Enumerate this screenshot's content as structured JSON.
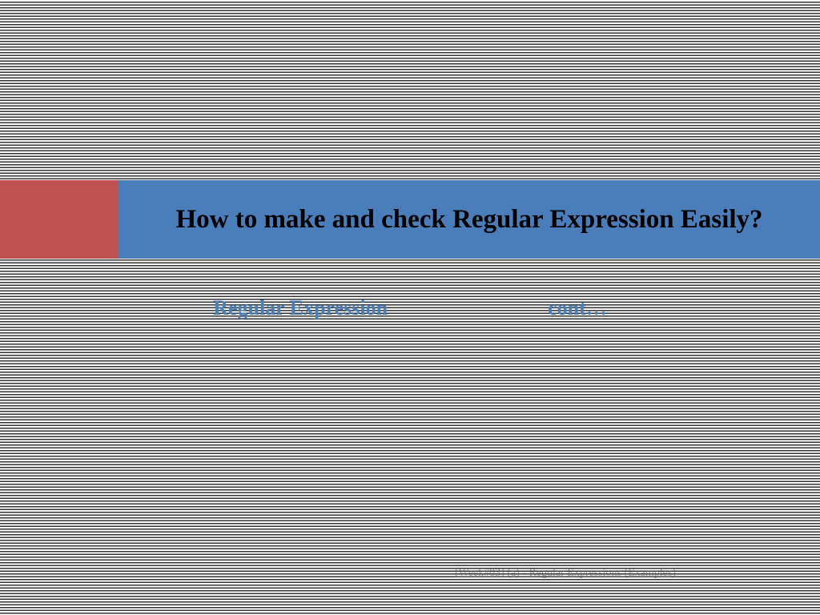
{
  "title": "How to make and check Regular Expression Easily?",
  "subtitle": {
    "left": "Regular Expression",
    "right": "cont…"
  },
  "footer": "[Week#03] (a) - Regular Expressions (Examples)"
}
